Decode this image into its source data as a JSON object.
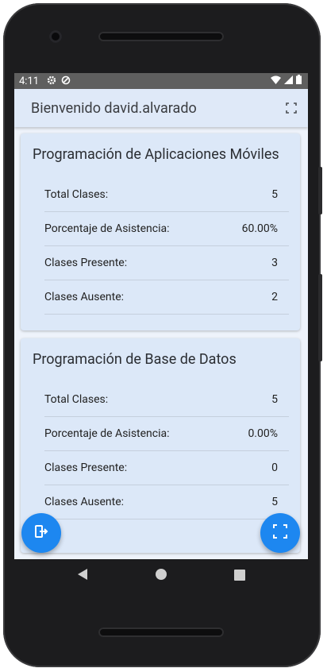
{
  "status": {
    "time": "4:11"
  },
  "appbar": {
    "title": "Bienvenido david.alvarado"
  },
  "courses": [
    {
      "title": "Programación de Aplicaciones Móviles",
      "rows": [
        {
          "label": "Total Clases:",
          "value": "5"
        },
        {
          "label": "Porcentaje de Asistencia:",
          "value": "60.00%"
        },
        {
          "label": "Clases Presente:",
          "value": "3"
        },
        {
          "label": "Clases Ausente:",
          "value": "2"
        }
      ]
    },
    {
      "title": "Programación de Base de Datos",
      "rows": [
        {
          "label": "Total Clases:",
          "value": "5"
        },
        {
          "label": "Porcentaje de Asistencia:",
          "value": "0.00%"
        },
        {
          "label": "Clases Presente:",
          "value": "0"
        },
        {
          "label": "Clases Ausente:",
          "value": "5"
        }
      ]
    }
  ],
  "colors": {
    "accent": "#1d87f0",
    "appbar": "#dfe9f8",
    "card": "#dce8f8"
  },
  "icons": {
    "logout": "logout-icon",
    "scan": "qr-scan-icon",
    "settings": "gear-icon",
    "back": "back-triangle-icon",
    "home": "home-circle-icon",
    "recents": "recents-square-icon"
  }
}
